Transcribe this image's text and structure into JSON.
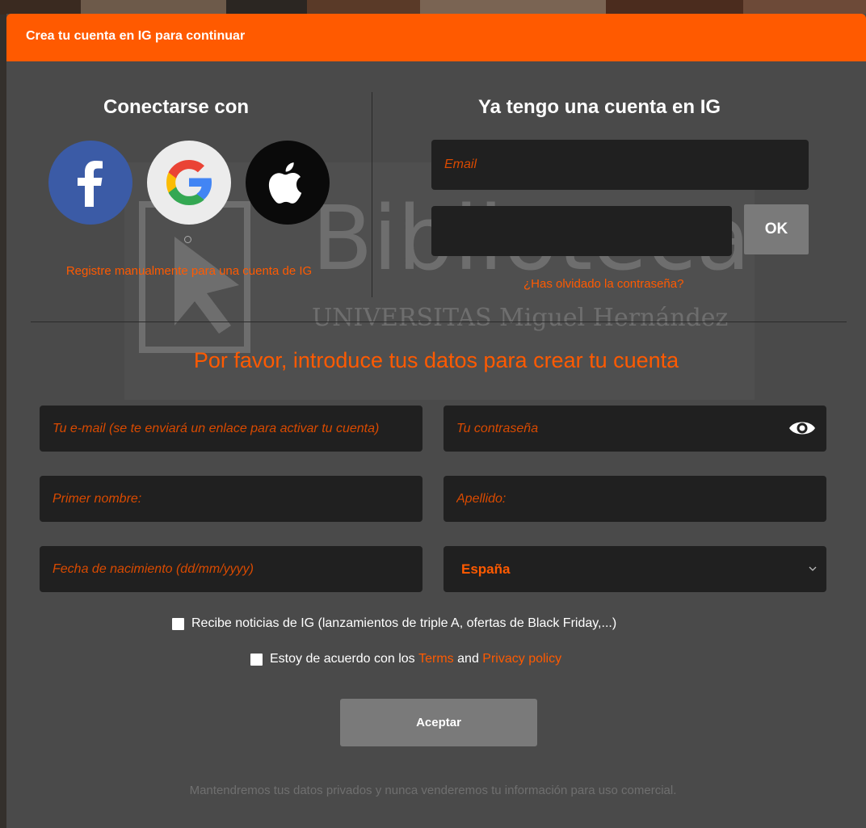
{
  "modal": {
    "title": "Crea tu cuenta en IG para continuar"
  },
  "social_login": {
    "heading": "Conectarse con",
    "providers": [
      {
        "name": "facebook",
        "icon": "facebook-icon",
        "color": "#3b5ba6"
      },
      {
        "name": "google",
        "icon": "google-icon",
        "color": "#ececec"
      },
      {
        "name": "apple",
        "icon": "apple-icon",
        "color": "#0a0a0a"
      }
    ],
    "register_link": "Registre manualmente para una cuenta de IG"
  },
  "login": {
    "heading": "Ya tengo una cuenta en IG",
    "email_placeholder": "Email",
    "password_placeholder": "",
    "ok_label": "OK",
    "forgot_link": "¿Has olvidado la contraseña?"
  },
  "register": {
    "heading": "Por favor, introduce tus datos para crear tu cuenta",
    "email_placeholder": "Tu e-mail (se te enviará un enlace para activar tu cuenta)",
    "password_placeholder": "Tu contraseña",
    "first_name_placeholder": "Primer nombre:",
    "last_name_placeholder": "Apellido:",
    "dob_placeholder": "Fecha de nacimiento (dd/mm/yyyy)",
    "country_value": "España",
    "newsletter_label": "Recibe noticias de IG (lanzamientos de triple A, ofertas de Black Friday,...)",
    "terms_prefix": "Estoy de acuerdo con los",
    "terms_link": "Terms",
    "terms_and": "and",
    "privacy_link": "Privacy policy",
    "accept_label": "Aceptar",
    "privacy_note": "Mantendremos tus datos privados y nunca venderemos tu información para uso comercial."
  },
  "colors": {
    "accent": "#ff5a00",
    "panel": "#4a4a4a",
    "field": "#202020",
    "button": "#7a7a7a"
  }
}
